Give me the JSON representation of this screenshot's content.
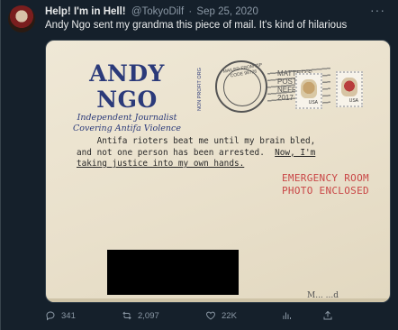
{
  "tweet": {
    "display_name": "Help! I'm in Hell!",
    "handle": "@TokyoDilf",
    "separator": "·",
    "time": "Sep 25, 2020",
    "text": "Andy Ngo sent my grandma this piece of mail. It's kind of hilarious",
    "more_label": "···"
  },
  "mail": {
    "logo_name": "ANDY NGO",
    "logo_line1": "Independent Journalist",
    "logo_line2": "Covering Antifa Violence",
    "nonprofit": "NON PROFIT ORG",
    "postmark_text": "MAILED FROM ZIP CODE 98726",
    "cancel_line1": "MATTER'S",
    "cancel_line2": "POSTMARK",
    "cancel_line3": "NEFR",
    "cancel_line4": "2017",
    "stamp_usa": "USA",
    "letter_line1": "    Antifa rioters beat me until my brain bled,",
    "letter_line2": "and not one person has been arrested.",
    "letter_line2b": "Now, I'm",
    "letter_line3": "taking justice into my own hands.",
    "red_stamp_line1": "EMERGENCY ROOM",
    "red_stamp_line2": "PHOTO ENCLOSED",
    "signature": "M... ...d"
  },
  "actions": {
    "reply_count": "341",
    "retweet_count": "2,097",
    "like_count": "22K"
  },
  "icons": {
    "reply": "reply-icon",
    "retweet": "retweet-icon",
    "like": "heart-icon",
    "views": "analytics-icon",
    "share": "share-icon"
  },
  "colors": {
    "background": "#15202b",
    "secondary_text": "#8b98a5",
    "logo_blue": "#2b3a7a",
    "red_stamp": "#c94646"
  }
}
